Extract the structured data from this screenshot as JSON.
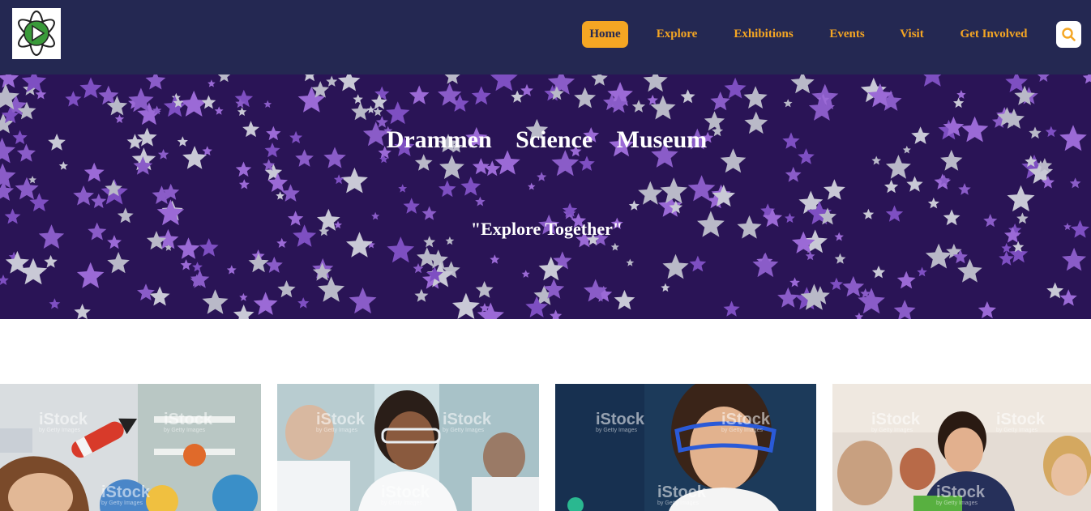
{
  "brand": {
    "logo_icon": "atom-play-logo",
    "accent_color": "#f5a623",
    "header_color": "#242852"
  },
  "nav": {
    "items": [
      {
        "label": "Home",
        "active": true
      },
      {
        "label": "Explore",
        "active": false
      },
      {
        "label": "Exhibitions",
        "active": false
      },
      {
        "label": "Events",
        "active": false
      },
      {
        "label": "Visit",
        "active": false
      },
      {
        "label": "Get Involved",
        "active": false
      }
    ],
    "search_icon": "search-icon"
  },
  "hero": {
    "title": "Drammen Science Museum",
    "tagline": "\"Explore Together\"",
    "background": "starry-night-pattern"
  },
  "cards": [
    {
      "subject": "boy-with-rocket-and-planets",
      "watermark": "iStock",
      "watermark_sub": "by Getty Images"
    },
    {
      "subject": "student-in-lab-goggles",
      "watermark": "iStock",
      "watermark_sub": "by Getty Images"
    },
    {
      "subject": "girl-with-safety-goggles",
      "watermark": "iStock",
      "watermark_sub": "by Getty Images"
    },
    {
      "subject": "students-working-together",
      "watermark": "iStock",
      "watermark_sub": "by Getty Images"
    }
  ]
}
